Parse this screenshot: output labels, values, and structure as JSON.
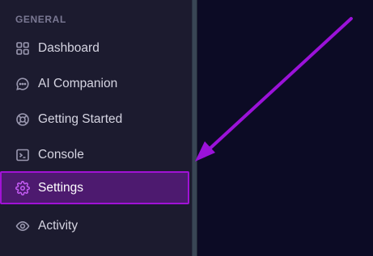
{
  "sidebar": {
    "section_label": "GENERAL",
    "items": [
      {
        "label": "Dashboard",
        "icon": "grid-icon"
      },
      {
        "label": "AI Companion",
        "icon": "chat-bubble-icon"
      },
      {
        "label": "Getting Started",
        "icon": "lifebuoy-icon"
      },
      {
        "label": "Console",
        "icon": "terminal-icon"
      },
      {
        "label": "Settings",
        "icon": "gear-icon",
        "active": true
      },
      {
        "label": "Activity",
        "icon": "eye-icon"
      }
    ]
  },
  "annotation": {
    "arrow_color": "#9b12d9",
    "highlight_color": "#a112d6"
  }
}
